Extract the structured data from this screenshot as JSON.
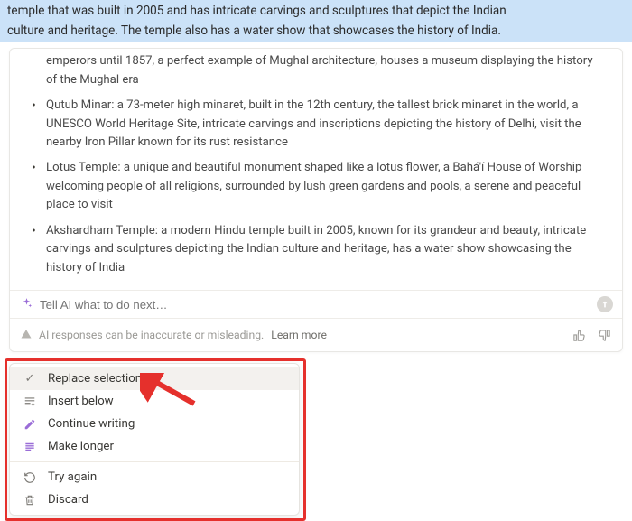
{
  "highlight": {
    "line1": "temple that was built in 2005 and has intricate carvings and sculptures that depict the Indian",
    "line2": "culture and heritage. The temple also has a water show that showcases the history of India."
  },
  "response": {
    "lead_fragment": "emperors until 1857, a perfect example of Mughal architecture, houses a museum displaying the history of the Mughal era",
    "items": [
      "Qutub Minar: a 73-meter high minaret, built in the 12th century, the tallest brick minaret in the world, a UNESCO World Heritage Site, intricate carvings and inscriptions depicting the history of Delhi, visit the nearby Iron Pillar known for its rust resistance",
      "Lotus Temple: a unique and beautiful monument shaped like a lotus flower, a Bahá'í House of Worship welcoming people of all religions, surrounded by lush green gardens and pools, a serene and peaceful place to visit",
      "Akshardham Temple: a modern Hindu temple built in 2005, known for its grandeur and beauty, intricate carvings and sculptures depicting the Indian culture and heritage, has a water show showcasing the history of India"
    ]
  },
  "ai_input": {
    "placeholder": "Tell AI what to do next…"
  },
  "disclaimer": {
    "text": "AI responses can be inaccurate or misleading.",
    "learn": "Learn more"
  },
  "menu": {
    "items": [
      {
        "label": "Replace selection"
      },
      {
        "label": "Insert below"
      },
      {
        "label": "Continue writing"
      },
      {
        "label": "Make longer"
      },
      {
        "label": "Try again"
      },
      {
        "label": "Discard"
      }
    ]
  }
}
